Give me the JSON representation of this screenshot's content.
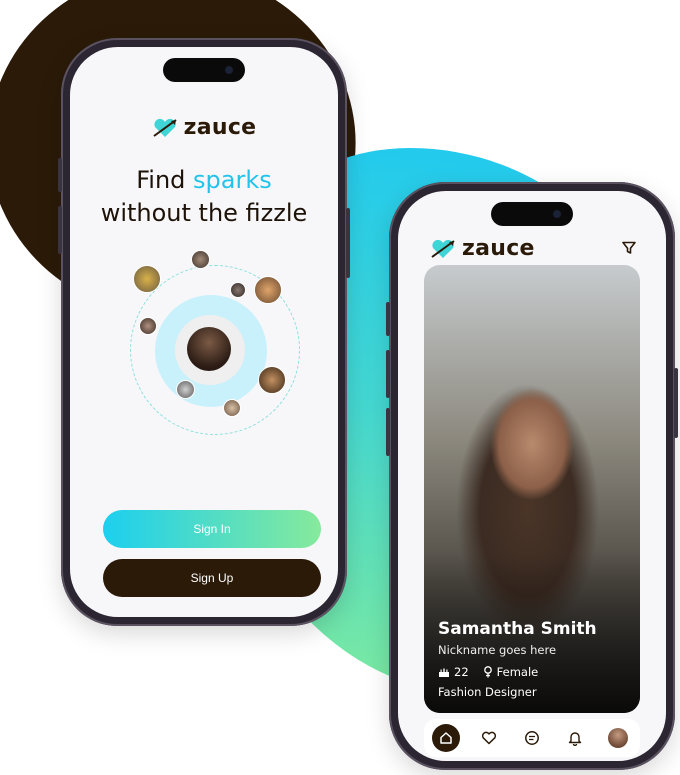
{
  "brand": {
    "name": "zauce",
    "accent": "#23c4ea",
    "dark": "#2b1a08"
  },
  "onboarding": {
    "headline_line1_pre": "Find ",
    "headline_line1_accent": "sparks",
    "headline_line2": "without the fizzle",
    "signin_label": "Sign In",
    "signup_label": "Sign Up"
  },
  "profile": {
    "name": "Samantha Smith",
    "nickname": "Nickname goes here",
    "age": "22",
    "gender": "Female",
    "occupation": "Fashion Designer"
  },
  "nav": {
    "items": [
      "home-icon",
      "heart-icon",
      "chat-icon",
      "bell-icon",
      "avatar"
    ],
    "active": "home-icon"
  }
}
